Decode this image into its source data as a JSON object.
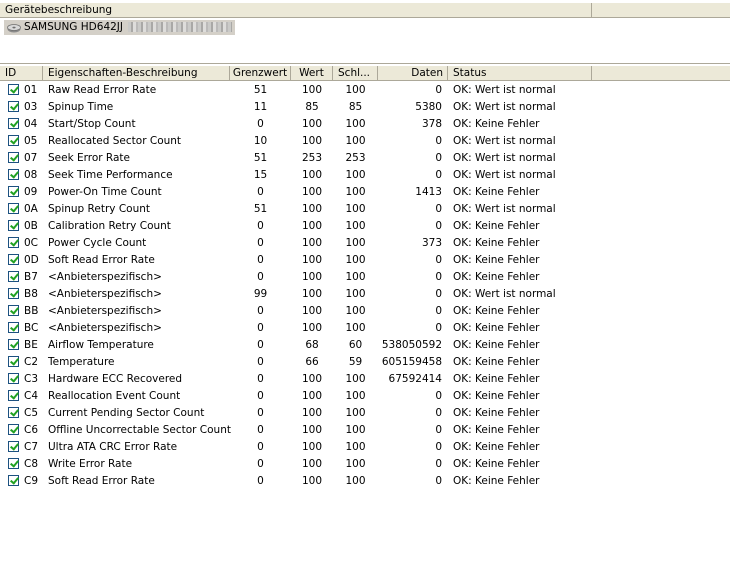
{
  "device_panel": {
    "header": "Gerätebeschreibung",
    "device_name": "SAMSUNG HD642JJ"
  },
  "columns": {
    "id": "ID",
    "desc": "Eigenschaften-Beschreibung",
    "threshold": "Grenzwert",
    "value": "Wert",
    "worst": "Schl...",
    "data": "Daten",
    "status": "Status"
  },
  "rows": [
    {
      "id": "01",
      "desc": "Raw Read Error Rate",
      "threshold": "51",
      "value": "100",
      "worst": "100",
      "data": "0",
      "status": "OK: Wert ist normal"
    },
    {
      "id": "03",
      "desc": "Spinup Time",
      "threshold": "11",
      "value": "85",
      "worst": "85",
      "data": "5380",
      "status": "OK: Wert ist normal"
    },
    {
      "id": "04",
      "desc": "Start/Stop Count",
      "threshold": "0",
      "value": "100",
      "worst": "100",
      "data": "378",
      "status": "OK: Keine Fehler"
    },
    {
      "id": "05",
      "desc": "Reallocated Sector Count",
      "threshold": "10",
      "value": "100",
      "worst": "100",
      "data": "0",
      "status": "OK: Wert ist normal"
    },
    {
      "id": "07",
      "desc": "Seek Error Rate",
      "threshold": "51",
      "value": "253",
      "worst": "253",
      "data": "0",
      "status": "OK: Wert ist normal"
    },
    {
      "id": "08",
      "desc": "Seek Time Performance",
      "threshold": "15",
      "value": "100",
      "worst": "100",
      "data": "0",
      "status": "OK: Wert ist normal"
    },
    {
      "id": "09",
      "desc": "Power-On Time Count",
      "threshold": "0",
      "value": "100",
      "worst": "100",
      "data": "1413",
      "status": "OK: Keine Fehler"
    },
    {
      "id": "0A",
      "desc": "Spinup Retry Count",
      "threshold": "51",
      "value": "100",
      "worst": "100",
      "data": "0",
      "status": "OK: Wert ist normal"
    },
    {
      "id": "0B",
      "desc": "Calibration Retry Count",
      "threshold": "0",
      "value": "100",
      "worst": "100",
      "data": "0",
      "status": "OK: Keine Fehler"
    },
    {
      "id": "0C",
      "desc": "Power Cycle Count",
      "threshold": "0",
      "value": "100",
      "worst": "100",
      "data": "373",
      "status": "OK: Keine Fehler"
    },
    {
      "id": "0D",
      "desc": "Soft Read Error Rate",
      "threshold": "0",
      "value": "100",
      "worst": "100",
      "data": "0",
      "status": "OK: Keine Fehler"
    },
    {
      "id": "B7",
      "desc": "<Anbieterspezifisch>",
      "threshold": "0",
      "value": "100",
      "worst": "100",
      "data": "0",
      "status": "OK: Keine Fehler"
    },
    {
      "id": "B8",
      "desc": "<Anbieterspezifisch>",
      "threshold": "99",
      "value": "100",
      "worst": "100",
      "data": "0",
      "status": "OK: Wert ist normal"
    },
    {
      "id": "BB",
      "desc": "<Anbieterspezifisch>",
      "threshold": "0",
      "value": "100",
      "worst": "100",
      "data": "0",
      "status": "OK: Keine Fehler"
    },
    {
      "id": "BC",
      "desc": "<Anbieterspezifisch>",
      "threshold": "0",
      "value": "100",
      "worst": "100",
      "data": "0",
      "status": "OK: Keine Fehler"
    },
    {
      "id": "BE",
      "desc": "Airflow Temperature",
      "threshold": "0",
      "value": "68",
      "worst": "60",
      "data": "538050592",
      "status": "OK: Keine Fehler"
    },
    {
      "id": "C2",
      "desc": "Temperature",
      "threshold": "0",
      "value": "66",
      "worst": "59",
      "data": "605159458",
      "status": "OK: Keine Fehler"
    },
    {
      "id": "C3",
      "desc": "Hardware ECC Recovered",
      "threshold": "0",
      "value": "100",
      "worst": "100",
      "data": "67592414",
      "status": "OK: Keine Fehler"
    },
    {
      "id": "C4",
      "desc": "Reallocation Event Count",
      "threshold": "0",
      "value": "100",
      "worst": "100",
      "data": "0",
      "status": "OK: Keine Fehler"
    },
    {
      "id": "C5",
      "desc": "Current Pending Sector Count",
      "threshold": "0",
      "value": "100",
      "worst": "100",
      "data": "0",
      "status": "OK: Keine Fehler"
    },
    {
      "id": "C6",
      "desc": "Offline Uncorrectable Sector Count",
      "threshold": "0",
      "value": "100",
      "worst": "100",
      "data": "0",
      "status": "OK: Keine Fehler"
    },
    {
      "id": "C7",
      "desc": "Ultra ATA CRC Error Rate",
      "threshold": "0",
      "value": "100",
      "worst": "100",
      "data": "0",
      "status": "OK: Keine Fehler"
    },
    {
      "id": "C8",
      "desc": "Write Error Rate",
      "threshold": "0",
      "value": "100",
      "worst": "100",
      "data": "0",
      "status": "OK: Keine Fehler"
    },
    {
      "id": "C9",
      "desc": "Soft Read Error Rate",
      "threshold": "0",
      "value": "100",
      "worst": "100",
      "data": "0",
      "status": "OK: Keine Fehler"
    }
  ],
  "icons": {
    "device": "hard-disk-icon",
    "row_check": "checkbox-checked-icon"
  }
}
